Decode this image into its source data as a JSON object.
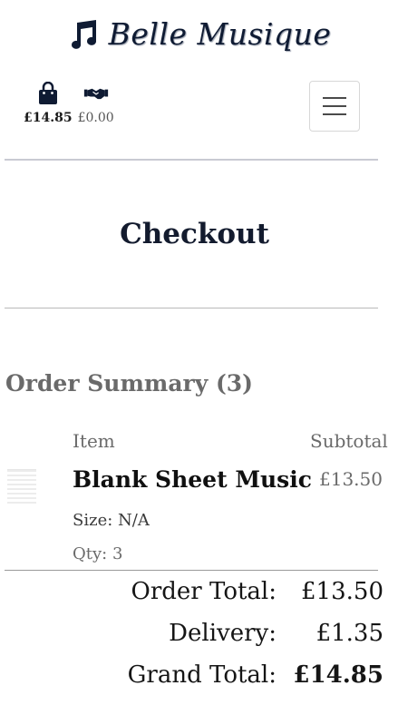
{
  "header": {
    "logo_text": "Belle Musique",
    "bag_total": "£14.85",
    "deals_total": "£0.00"
  },
  "page": {
    "title": "Checkout"
  },
  "order_summary": {
    "heading": "Order Summary (3)",
    "columns": {
      "item": "Item",
      "subtotal": "Subtotal"
    },
    "items": [
      {
        "name": "Blank Sheet Music",
        "price": "£13.50",
        "size": "Size: N/A",
        "qty": "Qty: 3"
      }
    ],
    "totals": [
      {
        "label": "Order Total:",
        "value": "£13.50"
      },
      {
        "label": "Delivery:",
        "value": "£1.35"
      },
      {
        "label": "Grand Total:",
        "value": "£14.85"
      }
    ]
  },
  "colors": {
    "brand_navy": "#0f1b33",
    "divider": "#c9cad3"
  }
}
